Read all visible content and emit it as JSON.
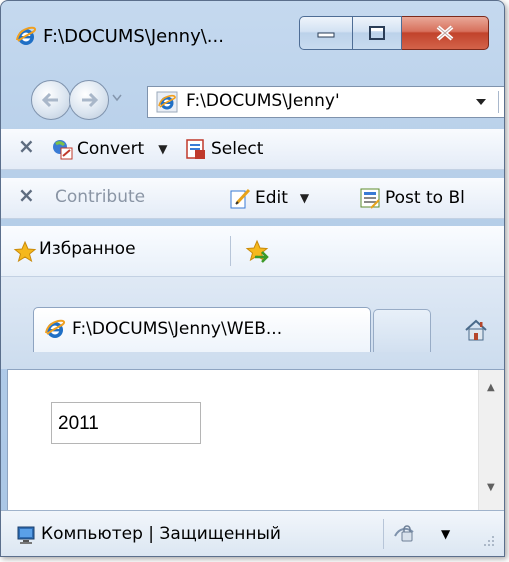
{
  "window": {
    "title": "F:\\DOCUMS\\Jenny\\..."
  },
  "navigation": {
    "address": "F:\\DOCUMS\\Jenny'"
  },
  "toolbar1": {
    "close_glyph": "×",
    "convert_label": "Convert",
    "select_label": "Select"
  },
  "toolbar2": {
    "close_glyph": "×",
    "contribute_label": "Contribute",
    "edit_label": "Edit",
    "post_label": "Post to Bl"
  },
  "favorites": {
    "label": "Избранное"
  },
  "tabs": {
    "active_label": "F:\\DOCUMS\\Jenny\\WEB..."
  },
  "content": {
    "year_value": "2011"
  },
  "statusbar": {
    "zone_text": "Компьютер | Защищенный"
  },
  "icons": [
    "ie-icon",
    "back-icon",
    "forward-icon",
    "home-icon",
    "star-icon",
    "add-favorite-icon",
    "convert-icon",
    "select-icon",
    "edit-icon",
    "post-icon",
    "computer-icon",
    "zoom-icon"
  ],
  "colors": {
    "frame": "#a9c6e6",
    "close_button": "#c1432b",
    "ie_blue": "#1f6fc5",
    "ie_orange": "#f0a020"
  }
}
